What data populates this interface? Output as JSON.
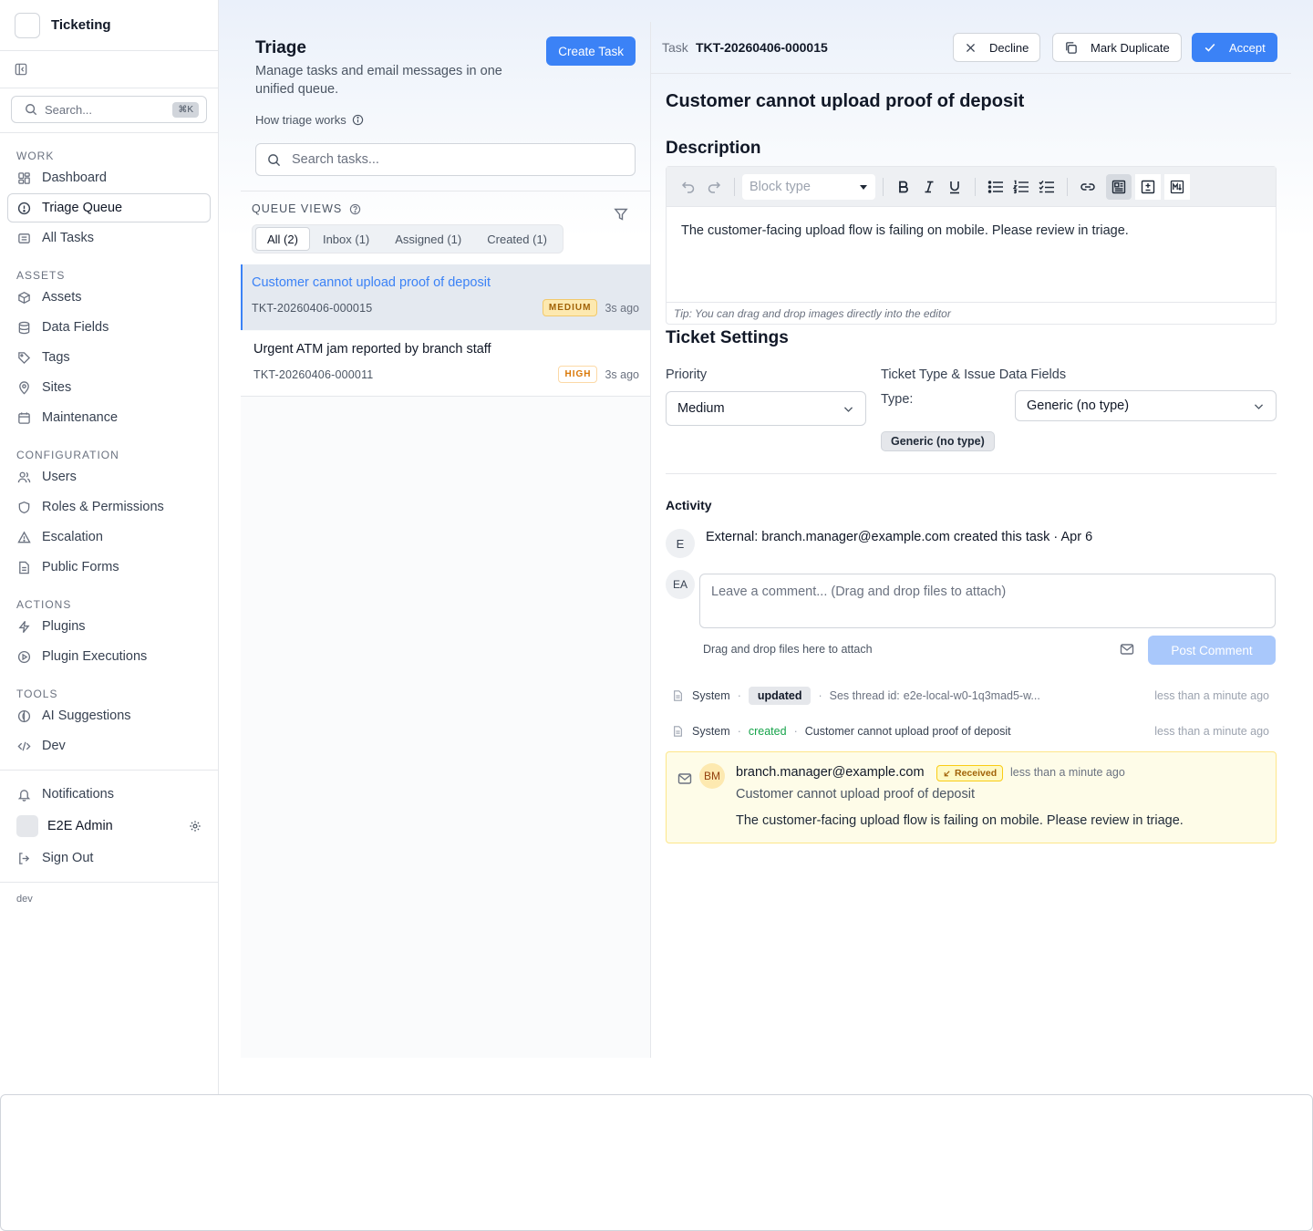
{
  "sidebar": {
    "app_name": "Ticketing",
    "search": {
      "placeholder": "Search...",
      "shortcut": "⌘K"
    },
    "sections": {
      "work": "WORK",
      "assets": "ASSETS",
      "configuration": "CONFIGURATION",
      "actions": "ACTIONS",
      "tools": "TOOLS"
    },
    "items": {
      "dashboard": "Dashboard",
      "triage_queue": "Triage Queue",
      "all_tasks": "All Tasks",
      "assets": "Assets",
      "data_fields": "Data Fields",
      "tags": "Tags",
      "sites": "Sites",
      "maintenance": "Maintenance",
      "users": "Users",
      "roles": "Roles & Permissions",
      "escalation": "Escalation",
      "public_forms": "Public Forms",
      "plugins": "Plugins",
      "plugin_executions": "Plugin Executions",
      "ai_suggestions": "AI Suggestions",
      "dev": "Dev"
    },
    "notifications": "Notifications",
    "user_name": "E2E Admin",
    "sign_out": "Sign Out",
    "env": "dev"
  },
  "triage": {
    "title": "Triage",
    "description": "Manage tasks and email messages in one unified queue.",
    "create_button": "Create Task",
    "how_works": "How triage works",
    "search_placeholder": "Search tasks...",
    "queue_views_label": "QUEUE VIEWS",
    "tabs": [
      "All (2)",
      "Inbox (1)",
      "Assigned (1)",
      "Created (1)"
    ],
    "tasks": [
      {
        "title": "Customer cannot upload proof of deposit",
        "key": "TKT-20260406-000015",
        "priority": "MEDIUM",
        "time": "3s ago"
      },
      {
        "title": "Urgent ATM jam reported by branch staff",
        "key": "TKT-20260406-000011",
        "priority": "HIGH",
        "time": "3s ago"
      }
    ]
  },
  "detail": {
    "task_label": "Task",
    "task_code": "TKT-20260406-000015",
    "decline": "Decline",
    "mark_duplicate": "Mark Duplicate",
    "accept": "Accept",
    "title": "Customer cannot upload proof of deposit",
    "description_heading": "Description",
    "block_type_placeholder": "Block type",
    "description_text": "The customer-facing upload flow is failing on mobile. Please review in triage.",
    "editor_tip": "Tip: You can drag and drop images directly into the editor",
    "settings_heading": "Ticket Settings",
    "priority_label": "Priority",
    "priority_value": "Medium",
    "type_section_label": "Ticket Type & Issue Data Fields",
    "type_label": "Type:",
    "type_value": "Generic (no type)",
    "type_chip": "Generic (no type)",
    "activity": {
      "title": "Activity",
      "creator_avatar": "E",
      "creator_line": "External: branch.manager@example.com",
      "created_text": "created this task · Apr 6",
      "me_avatar": "EA",
      "comment_placeholder": "Leave a comment... (Drag and drop files to attach)",
      "drag_hint": "Drag and drop files here to attach",
      "post_button": "Post Comment",
      "log": [
        {
          "actor": "System",
          "action": "updated",
          "detail_label": "Ses thread id:",
          "detail_value": "e2e-local-w0-1q3mad5-w...",
          "time": "less than a minute ago"
        },
        {
          "actor": "System",
          "action": "created",
          "detail_value": "Customer cannot upload proof of deposit",
          "time": "less than a minute ago"
        }
      ],
      "email": {
        "avatar": "BM",
        "from": "branch.manager@example.com",
        "badge": "Received",
        "time": "less than a minute ago",
        "subject": "Customer cannot upload proof of deposit",
        "body": "The customer-facing upload flow is failing on mobile. Please review in triage."
      }
    }
  },
  "colors": {
    "accent": "#3b82f6",
    "medium_badge": "#fde9b0",
    "high_badge_text": "#d97706",
    "created_green": "#16a34a",
    "email_card_bg": "#fefce8"
  }
}
